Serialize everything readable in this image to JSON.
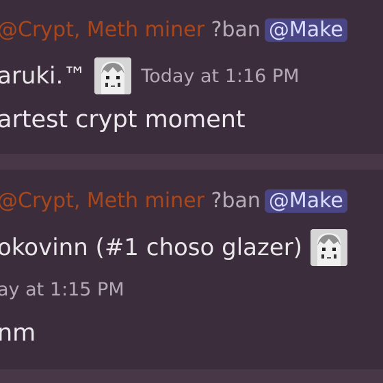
{
  "messages": [
    {
      "reply": {
        "mention": "@Crypt, Meth miner",
        "command": " ?ban",
        "pinged": "@Make"
      },
      "author": "aruki.™",
      "timestamp": "Today at 1:16 PM",
      "text": "artest crypt moment"
    },
    {
      "reply": {
        "mention": "@Crypt, Meth miner",
        "command": " ?ban",
        "pinged": "@Make"
      },
      "author": "okovinn (#1 choso glazer)",
      "timestamp": "ay at 1:15 PM",
      "text": "nm"
    }
  ],
  "colors": {
    "background": "#3b2d3b",
    "separator": "#473747",
    "reply_mention": "#a8471c",
    "mention_chip": "#4a4585"
  },
  "icons": {
    "avatar_badge": "anime-avatar-icon"
  }
}
